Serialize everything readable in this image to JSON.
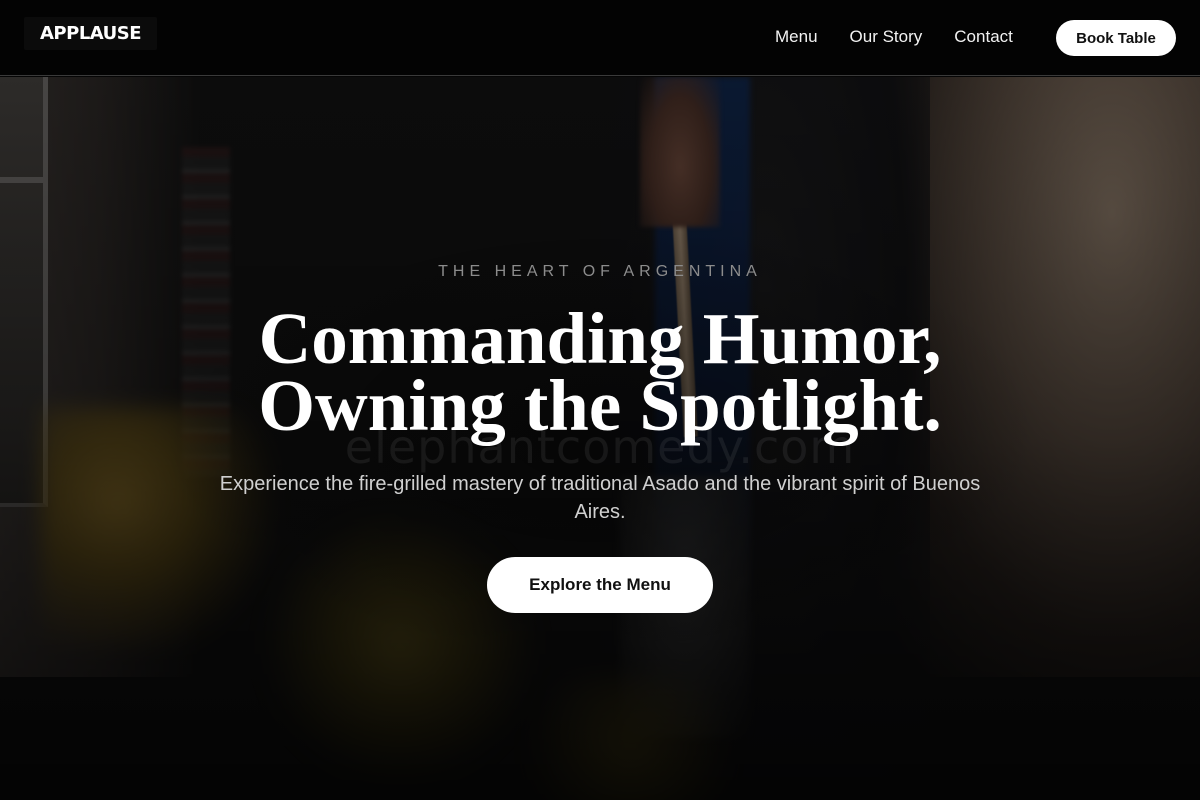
{
  "header": {
    "brand": "APPLAUSE",
    "nav": [
      {
        "label": "Menu"
      },
      {
        "label": "Our Story"
      },
      {
        "label": "Contact"
      }
    ],
    "cta_label": "Book Table"
  },
  "hero": {
    "eyebrow": "THE HEART OF ARGENTINA",
    "headline_line1": "Commanding Humor,",
    "headline_line2": "Owning the Spotlight.",
    "subtext": "Experience the fire-grilled mastery of traditional Asado and the vibrant spirit of Buenos Aires.",
    "cta_label": "Explore the Menu",
    "watermark": "elephantcomedy.com"
  },
  "colors": {
    "background": "#050505",
    "button_bg": "#ffffff",
    "button_text": "#111111",
    "eyebrow": "#8c8c8c"
  }
}
